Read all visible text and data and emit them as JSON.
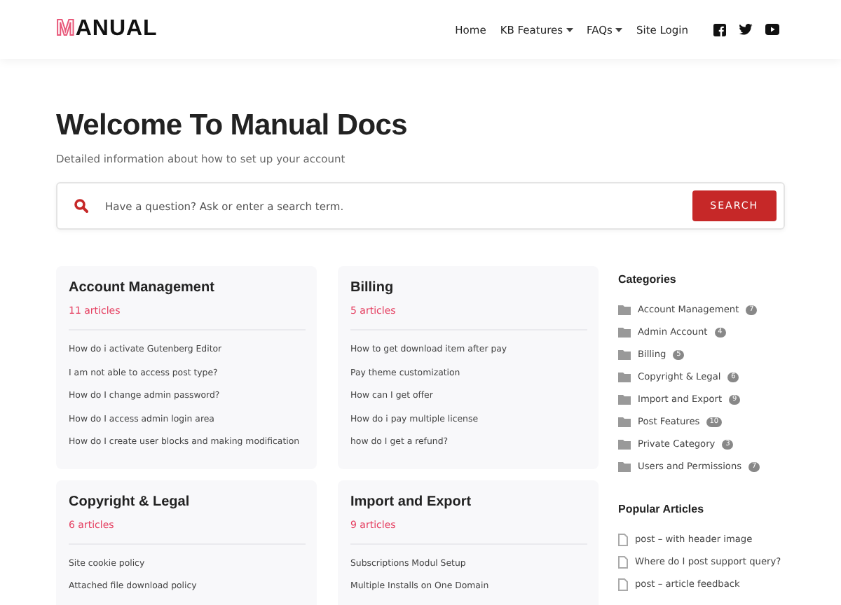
{
  "header": {
    "logo": {
      "mark": "M",
      "text": "ANUAL"
    },
    "nav": [
      {
        "label": "Home",
        "dropdown": false
      },
      {
        "label": "KB Features",
        "dropdown": true
      },
      {
        "label": "FAQs",
        "dropdown": true
      },
      {
        "label": "Site Login",
        "dropdown": false
      }
    ],
    "social": [
      {
        "kind": "facebook"
      },
      {
        "kind": "twitter"
      },
      {
        "kind": "youtube"
      }
    ]
  },
  "hero": {
    "title": "Welcome To Manual Docs",
    "subtitle": "Detailed information about how to set up your account"
  },
  "search": {
    "placeholder": "Have a question? Ask or enter a search term.",
    "button": "SEARCH"
  },
  "cards": [
    {
      "title": "Account Management",
      "count": "11 articles",
      "articles": [
        "How do i activate Gutenberg Editor",
        "I am not able to access post type?",
        "How do I change admin password?",
        "How do I access admin login area",
        "How do I create user blocks and making modification"
      ]
    },
    {
      "title": "Billing",
      "count": "5 articles",
      "articles": [
        "How to get download item after pay",
        "Pay theme customization",
        "How can I get offer",
        "How do i pay multiple license",
        "how do I get a refund?"
      ]
    },
    {
      "title": "Copyright & Legal",
      "count": "6 articles",
      "articles": [
        "Site cookie policy",
        "Attached file download policy"
      ]
    },
    {
      "title": "Import and Export",
      "count": "9 articles",
      "articles": [
        "Subscriptions Modul Setup",
        "Multiple Installs on One Domain"
      ]
    }
  ],
  "sidebar": {
    "categories": {
      "title": "Categories",
      "items": [
        {
          "label": "Account Management",
          "count": "7"
        },
        {
          "label": "Admin Account",
          "count": "4"
        },
        {
          "label": "Billing",
          "count": "5"
        },
        {
          "label": "Copyright & Legal",
          "count": "6"
        },
        {
          "label": "Import and Export",
          "count": "9"
        },
        {
          "label": "Post Features",
          "count": "10"
        },
        {
          "label": "Private Category",
          "count": "3"
        },
        {
          "label": "Users and Permissions",
          "count": "7"
        }
      ]
    },
    "popular": {
      "title": "Popular Articles",
      "items": [
        "post – with header image",
        "Where do I post support query?",
        "post – article feedback"
      ]
    }
  }
}
